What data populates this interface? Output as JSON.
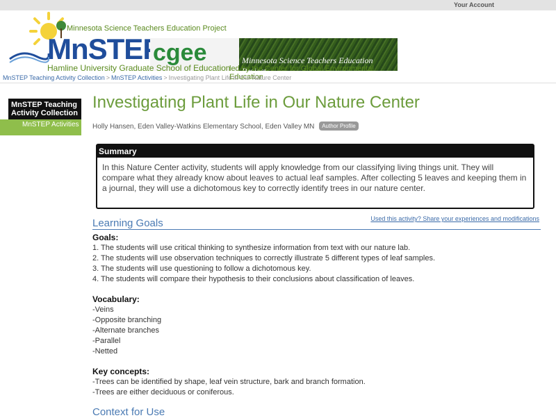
{
  "topbar": {
    "account_label": "Your Account"
  },
  "banner": {
    "project_small": "Minnesota Science Teachers Education Project",
    "mnstep_logo": "MnSTEP",
    "cgee_logo": "cgee",
    "cgee_tagline": "Minnesota Science Teachers Education Project",
    "hamline": "Hamline University Graduate School of Education",
    "led_by": "led by the Center for Global Environmental Education"
  },
  "breadcrumb": {
    "items": [
      "MnSTEP Teaching Activity Collection",
      "MnSTEP Activities"
    ],
    "current": "Investigating Plant Life in Our Nature Center",
    "separator": ">"
  },
  "sidebar": {
    "heading": "MnSTEP Teaching Activity Collection",
    "item": "MnSTEP Activities"
  },
  "main": {
    "title": "Investigating Plant Life in Our Nature Center",
    "author": "Holly Hansen, Eden Valley-Watkins Elementary School, Eden Valley MN",
    "author_button": "Author Profile",
    "summary_heading": "Summary",
    "summary_text": "In this Nature Center activity, students will apply knowledge from our classifying living things unit. They will compare what they already know about leaves to actual leaf samples. After collecting 5 leaves and keeping them in a journal, they will use a dichotomous key to correctly identify trees in our nature center.",
    "learning_goals_heading": "Learning Goals",
    "used_link": "Used this activity? Share your experiences and modifications",
    "goals_label": "Goals:",
    "goals": [
      "1. The students will use critical thinking to synthesize information from text with our nature lab.",
      "2. The students will use observation techniques to correctly illustrate 5 different types of leaf samples.",
      "3. The students will use questioning to follow a dichotomous key.",
      "4. The students will compare their hypothesis to their conclusions about classification of leaves."
    ],
    "vocab_label": "Vocabulary:",
    "vocab": [
      "-Veins",
      "-Opposite branching",
      "-Alternate branches",
      "-Parallel",
      "-Netted"
    ],
    "concepts_label": "Key concepts:",
    "concepts": [
      "-Trees can be identified by shape, leaf vein structure, bark and branch formation.",
      "-Trees are either deciduous or coniferous."
    ],
    "context_heading": "Context for Use"
  },
  "colors": {
    "title_green": "#6c9c3c",
    "link_blue": "#3a6aa8",
    "heading_blue": "#4a7ab3",
    "sidebar_green": "#8fbe4b"
  }
}
